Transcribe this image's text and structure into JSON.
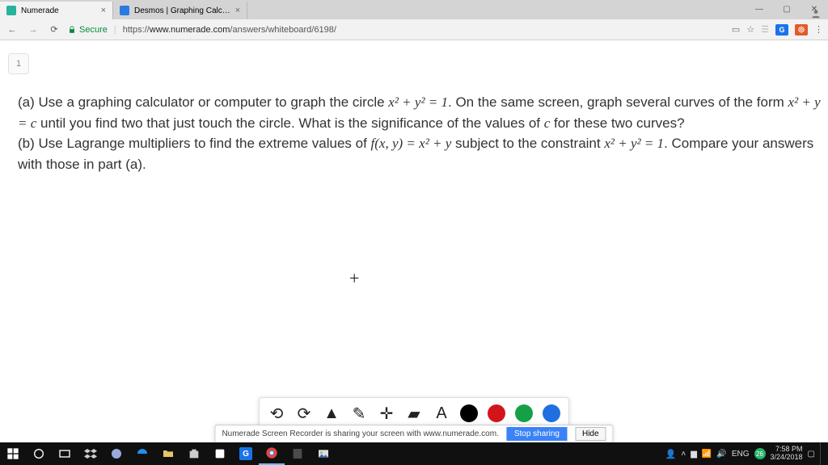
{
  "tabs": [
    {
      "title": "Numerade",
      "active": true
    },
    {
      "title": "Desmos | Graphing Calc…",
      "active": false
    }
  ],
  "window_controls": {
    "min": "—",
    "max": "▢",
    "close": "✕"
  },
  "addr": {
    "secure_label": "Secure",
    "url_prefix": "https://",
    "url_domain": "www.numerade.com",
    "url_path": "/answers/whiteboard/6198/",
    "star": "☆",
    "menu": "⋮"
  },
  "ext_badges": {
    "g": "G",
    "o": "◎"
  },
  "page_tab_label": "1",
  "problem": {
    "a_prefix": "(a) Use a graphing calculator or computer to graph the circle ",
    "a_mid": ". On the same screen, graph several curves of the form ",
    "a_tail": " until you find two that just touch the circle. What is the significance of the values of ",
    "a_tail2": " for these two curves?",
    "b_prefix": "(b) Use Lagrange multipliers to find the extreme values of ",
    "b_mid": " subject to the constraint ",
    "b_tail": ". Compare your answers with those in part (a).",
    "eq_circle": "x² + y² = 1",
    "eq_curve": "x² + y = c",
    "var_c": "c",
    "eq_f": "f(x, y) = x² + y",
    "eq_constraint": "x² + y² = 1"
  },
  "plus_symbol": "+",
  "wb_tools": {
    "undo": "⟲",
    "redo": "⟳",
    "point": "▲",
    "pen": "✎",
    "plus": "✛",
    "rect": "▰",
    "text": "A"
  },
  "share": {
    "text": "Numerade Screen Recorder is sharing your screen with www.numerade.com.",
    "stop": "Stop sharing",
    "hide": "Hide"
  },
  "tray": {
    "lang": "ENG",
    "time": "7:58 PM",
    "date": "3/24/2018",
    "badge": "26"
  }
}
